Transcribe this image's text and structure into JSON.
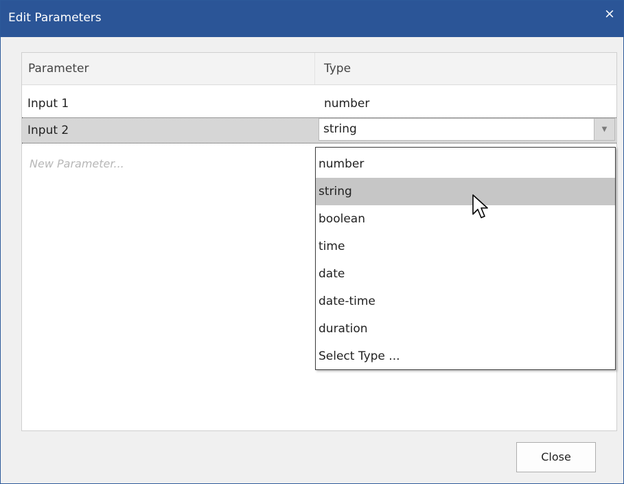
{
  "window": {
    "title": "Edit Parameters",
    "close_glyph": "×"
  },
  "grid": {
    "columns": [
      "Parameter",
      "Type"
    ],
    "rows": [
      {
        "parameter": "Input 1",
        "type": "number"
      },
      {
        "parameter": "Input 2",
        "type": "string"
      }
    ],
    "new_row_placeholder": "New Parameter..."
  },
  "combo": {
    "value": "string",
    "arrow_glyph": "▼"
  },
  "dropdown": {
    "options": [
      "number",
      "string",
      "boolean",
      "time",
      "date",
      "date-time",
      "duration",
      "Select Type ..."
    ],
    "selected_index": 1
  },
  "footer": {
    "close_label": "Close"
  },
  "colors": {
    "titlebar": "#2b5597",
    "selection": "#c6c6c6"
  }
}
